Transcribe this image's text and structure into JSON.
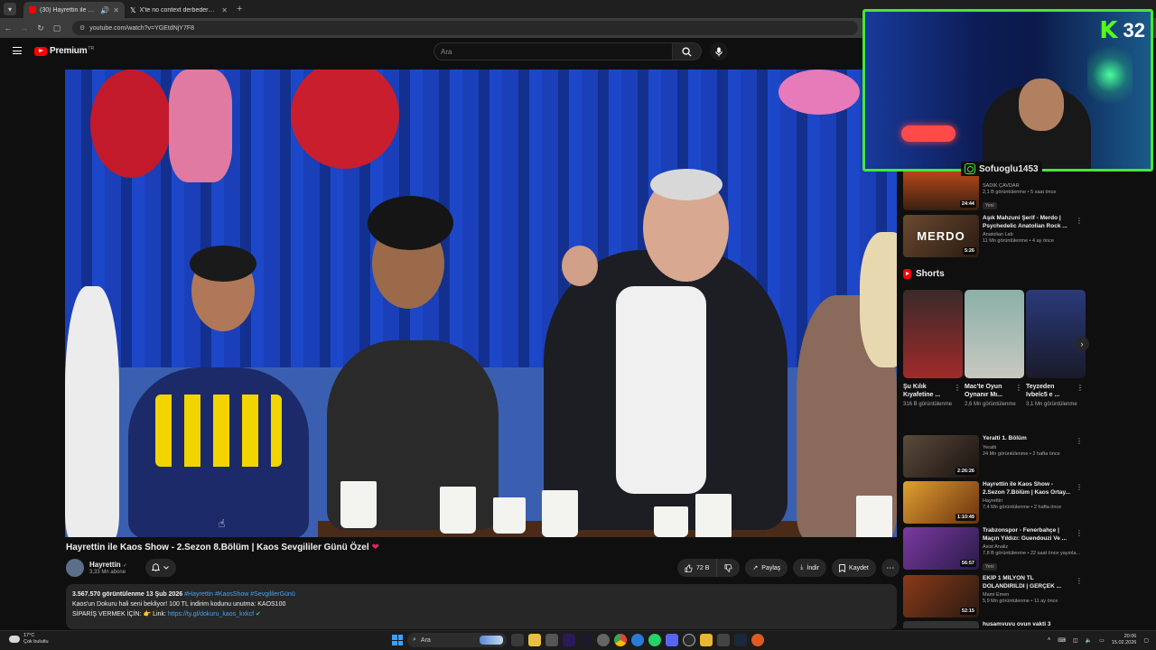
{
  "browser": {
    "tabs": [
      {
        "title": "(30) Hayrettin ile Kaos Show",
        "active": true
      },
      {
        "title": "X'te no context derbederberk",
        "active": false
      }
    ],
    "new_tab": "+",
    "url": "youtube.com/watch?v=YGEtdNjY7F8"
  },
  "header": {
    "logo_text": "Premium",
    "logo_sup": "TR",
    "search_placeholder": "Ara"
  },
  "video": {
    "title": "Hayrettin ile Kaos Show - 2.Sezon 8.Bölüm | Kaos Sevgililer Günü Özel",
    "title_emoji": "❤",
    "channel_name": "Hayrettin",
    "channel_verified": "✓",
    "subscribers": "3,33 Mn abone",
    "bell": "🔔",
    "likes": "72 B",
    "share": "Paylaş",
    "download": "İndir",
    "save": "Kaydet",
    "more": "⋯"
  },
  "description": {
    "views": "3.567.570 görüntülenme",
    "date": "13 Şub 2026",
    "hashtags": "#Hayrettin #KaosShow #SevgililerGünü",
    "line2": "Kaos'un Dokuru hali seni bekliyor! 100 TL indirim kodunu unutma: KAOS100",
    "line3_prefix": "SİPARİŞ VERMEK İÇİN: 👉 Link:",
    "line3_link": "https://ty.gl/dokuru_kaos_kxkcf"
  },
  "sidebar": {
    "recs_top": [
      {
        "title": "",
        "channel": "SADIK ÇAVDAR",
        "meta": "2,1 B görüntülenme • 5 saat önce",
        "badge": "Yeni",
        "duration": "24:44",
        "thumb_color": "#7a3a1a"
      },
      {
        "title": "Aşık Mahzuni Şerif - Merdo | Psychedelic Anatolian Rock ...",
        "channel": "Anatolian Lab",
        "meta": "11 Mn görüntülenme • 4 ay önce",
        "badge": "",
        "duration": "5:26",
        "thumb_color": "#4a3020",
        "thumb_text": "MERDO"
      }
    ],
    "shorts_label": "Shorts",
    "shorts": [
      {
        "title": "Şu Kılık Kıyafetine ...",
        "views": "316 B görüntülenme",
        "color": "#6a2a2a"
      },
      {
        "title": "Mac'te Oyun Oynanır Mı...",
        "views": "2,6 Mn görüntülenme",
        "color": "#6a8a80"
      },
      {
        "title": "Teyzeden Ivbelc5 e ...",
        "views": "3,1 Mn görüntülenme",
        "color": "#2a3a6a"
      }
    ],
    "recs_bottom": [
      {
        "title": "Yeralti 1. Bölüm",
        "channel": "Yeralti",
        "meta": "24 Mn görüntülenme • 2 hafta önce",
        "badge": "",
        "duration": "2:26:26",
        "thumb_color": "#3a2a20"
      },
      {
        "title": "Hayrettin ile Kaos Show - 2.Sezon 7.Bölüm | Kaos Ortay...",
        "channel": "Hayrettin",
        "meta": "7,4 Mn görüntülenme • 2 hafta önce",
        "badge": "",
        "duration": "1:10:49",
        "thumb_color": "#a06020"
      },
      {
        "title": "Trabzonspor - Fenerbahçe | Maçın Yıldızı: Guendouzi Ve ...",
        "channel": "Asist Analiz",
        "meta": "7,8 B görüntülenme • 22 saat önce yayınla...",
        "badge": "Yeni",
        "duration": "56:57",
        "thumb_color": "#4a2a6a"
      },
      {
        "title": "EKİP 1 MİLYON TL DOLANDIRILDI | GERÇEK ...",
        "channel": "Mami Emen",
        "meta": "5,9 Mn görüntülenme • 11 ay önce",
        "badge": "",
        "duration": "52:15",
        "thumb_color": "#5a2a1a"
      },
      {
        "title": "husamvuvu ovun vakti 3",
        "channel": "",
        "meta": "",
        "badge": "",
        "duration": "",
        "thumb_color": "#333333"
      }
    ]
  },
  "overlay": {
    "kick_logo": "K",
    "kick_number": "32",
    "instagram_handle": "Sofuoglu1453"
  },
  "taskbar": {
    "temperature": "17°C",
    "weather": "Çok bulutlu",
    "search": "Ara",
    "time": "20:06",
    "date": "15.02.2026"
  }
}
